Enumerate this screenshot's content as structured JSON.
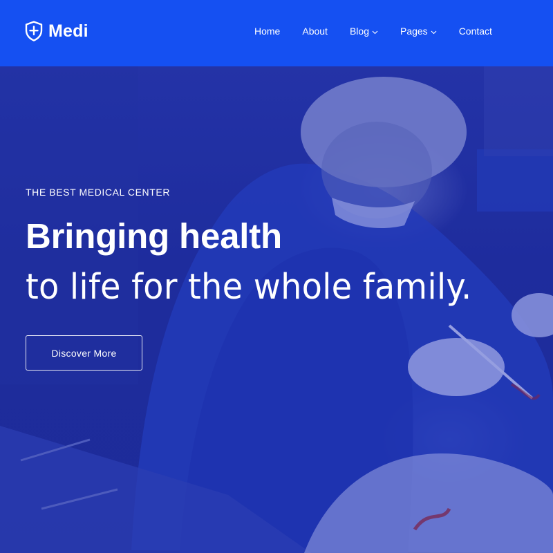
{
  "brand": {
    "name": "Medi",
    "icon": "shield-cross-icon"
  },
  "nav": {
    "items": [
      {
        "label": "Home"
      },
      {
        "label": "About"
      },
      {
        "label": "Blog",
        "icon": "chevron-down-icon"
      },
      {
        "label": "Pages",
        "icon": "chevron-down-icon"
      },
      {
        "label": "Contact"
      }
    ]
  },
  "hero": {
    "eyebrow": "THE BEST MEDICAL CENTER",
    "headline_bold": "Bringing health",
    "headline_light": "to life for the whole family.",
    "cta_label": "Discover More"
  },
  "colors": {
    "header_bg": "#1550f2",
    "hero_tint": "#2a3ca6",
    "text": "#ffffff"
  }
}
